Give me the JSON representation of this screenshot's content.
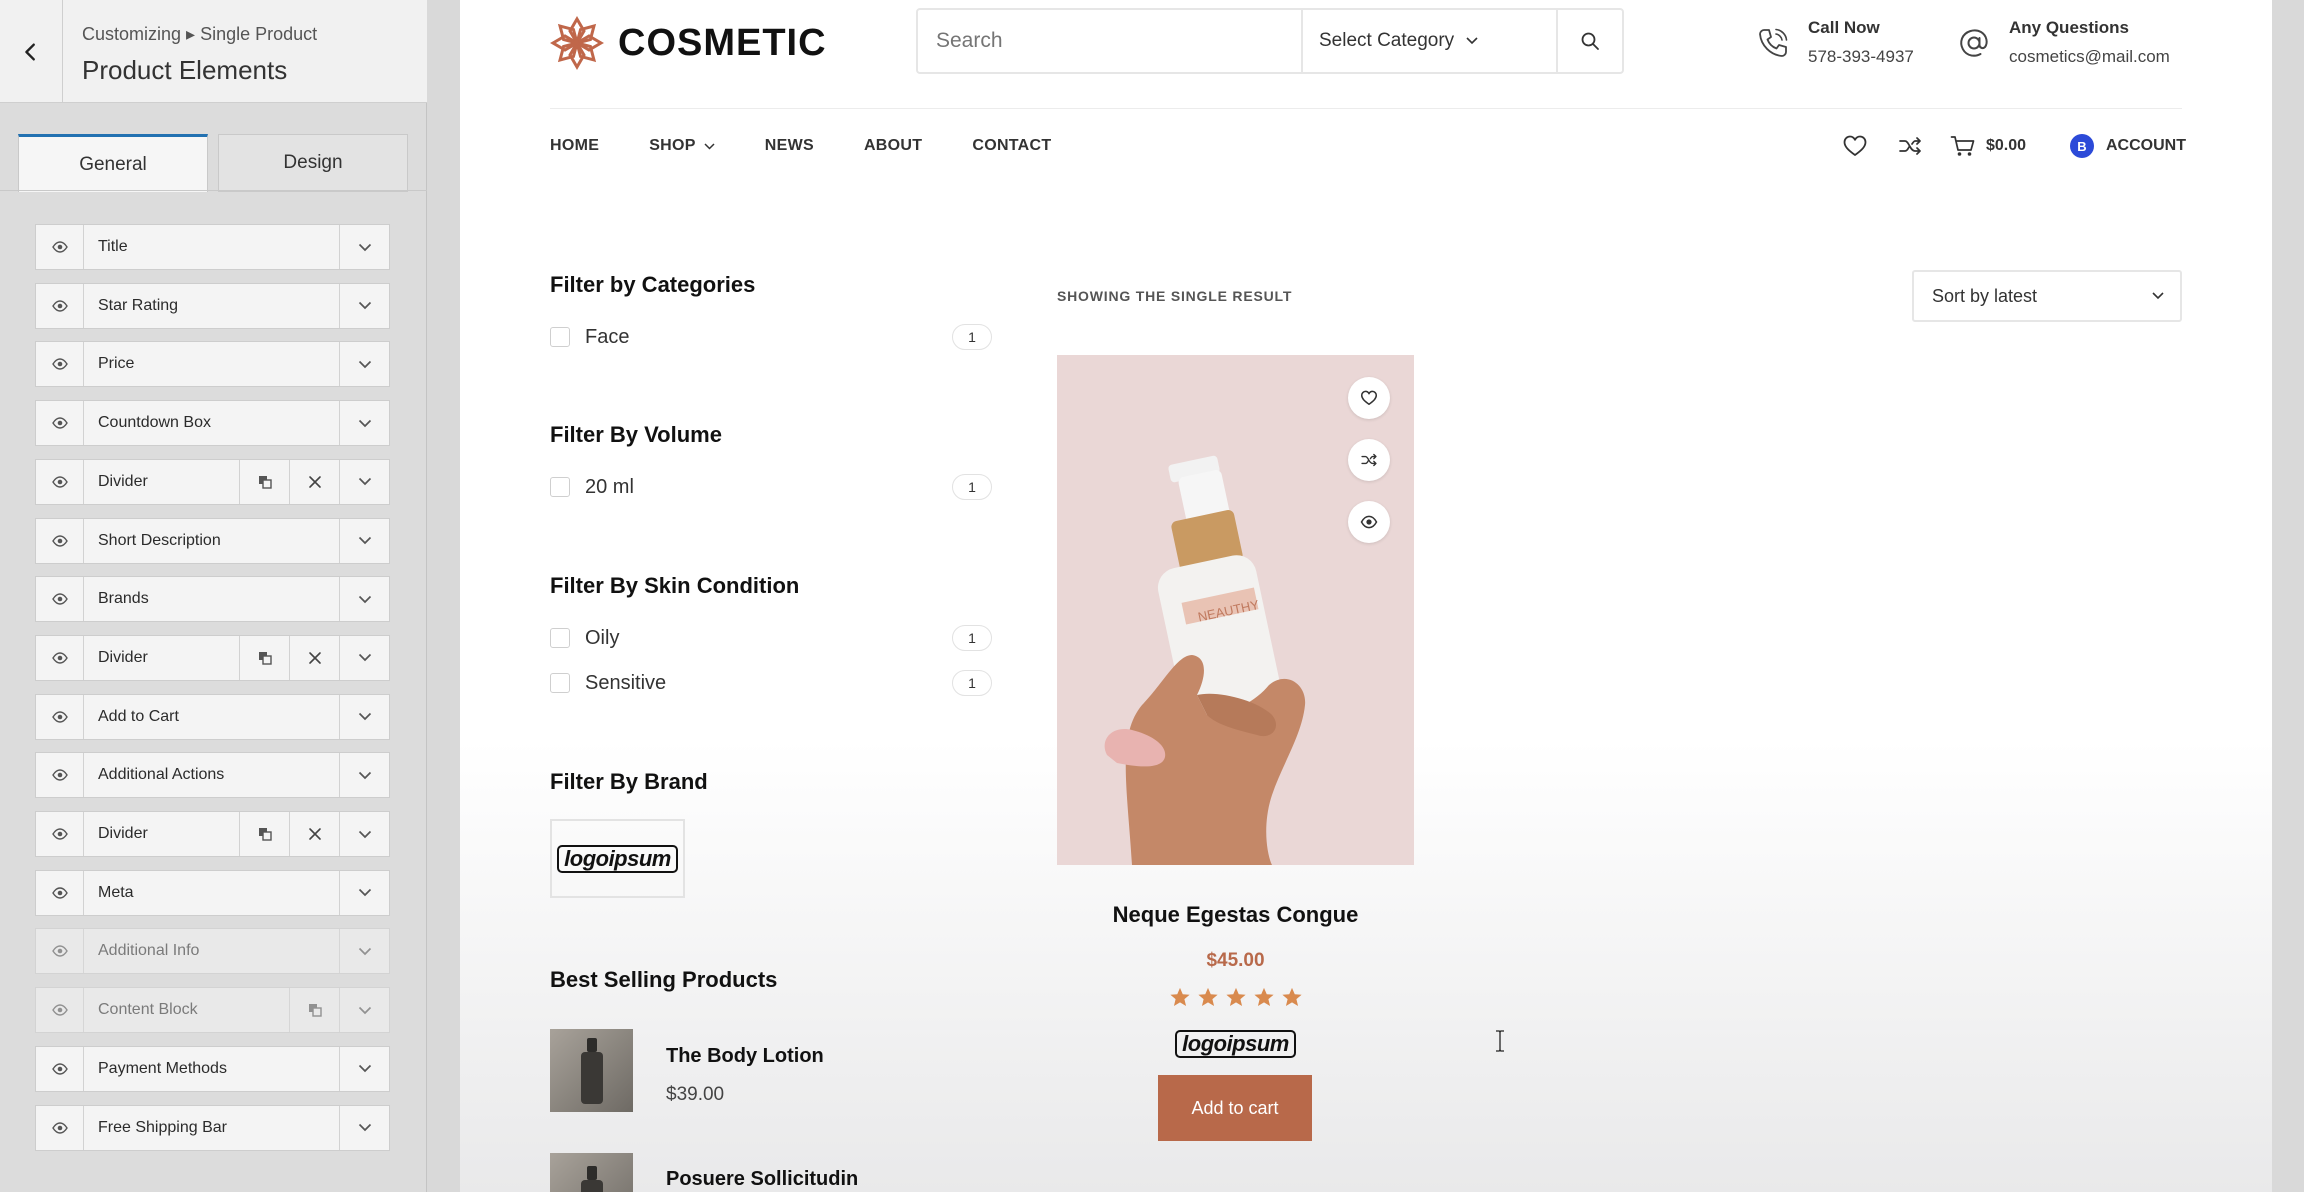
{
  "customizer": {
    "breadcrumb": "Customizing ▸ Single Product",
    "title": "Product Elements",
    "tabs": [
      {
        "label": "General",
        "active": true
      },
      {
        "label": "Design",
        "active": false
      }
    ],
    "elements": [
      {
        "label": "Title",
        "visible": true,
        "duplicable": false
      },
      {
        "label": "Star Rating",
        "visible": true,
        "duplicable": false
      },
      {
        "label": "Price",
        "visible": true,
        "duplicable": false
      },
      {
        "label": "Countdown Box",
        "visible": true,
        "duplicable": false
      },
      {
        "label": "Divider",
        "visible": true,
        "duplicable": true,
        "removable": true
      },
      {
        "label": "Short Description",
        "visible": true,
        "duplicable": false
      },
      {
        "label": "Brands",
        "visible": true,
        "duplicable": false
      },
      {
        "label": "Divider",
        "visible": true,
        "duplicable": true,
        "removable": true
      },
      {
        "label": "Add to Cart",
        "visible": true,
        "duplicable": false
      },
      {
        "label": "Additional Actions",
        "visible": true,
        "duplicable": false
      },
      {
        "label": "Divider",
        "visible": true,
        "duplicable": true,
        "removable": true
      },
      {
        "label": "Meta",
        "visible": true,
        "duplicable": false
      },
      {
        "label": "Additional Info",
        "visible": false,
        "duplicable": false
      },
      {
        "label": "Content Block",
        "visible": false,
        "duplicable": true,
        "removable": false
      },
      {
        "label": "Payment Methods",
        "visible": true,
        "duplicable": false
      },
      {
        "label": "Free Shipping Bar",
        "visible": true,
        "duplicable": false
      }
    ]
  },
  "site": {
    "logo_text": "COSMETIC",
    "search": {
      "placeholder": "Search",
      "category": "Select Category"
    },
    "call": {
      "label": "Call Now",
      "value": "578-393-4937"
    },
    "questions": {
      "label": "Any Questions",
      "value": "cosmetics@mail.com"
    },
    "nav": [
      "HOME",
      "SHOP",
      "NEWS",
      "ABOUT",
      "CONTACT"
    ],
    "cart_total": "$0.00",
    "account_badge": "B",
    "account_label": "ACCOUNT",
    "filters": {
      "categories": {
        "title": "Filter by Categories",
        "options": [
          {
            "label": "Face",
            "count": "1"
          }
        ]
      },
      "volume": {
        "title": "Filter By Volume",
        "options": [
          {
            "label": "20 ml",
            "count": "1"
          }
        ]
      },
      "skin": {
        "title": "Filter By Skin Condition",
        "options": [
          {
            "label": "Oily",
            "count": "1"
          },
          {
            "label": "Sensitive",
            "count": "1"
          }
        ]
      },
      "brand": {
        "title": "Filter By Brand",
        "logo": "logoipsum"
      }
    },
    "best_selling": {
      "title": "Best Selling Products",
      "items": [
        {
          "name": "The Body Lotion",
          "price": "$39.00"
        },
        {
          "name": "Posuere Sollicitudin",
          "price": ""
        }
      ]
    },
    "results_text": "SHOWING THE SINGLE RESULT",
    "sort": "Sort by latest",
    "product": {
      "name": "Neque Egestas Congue",
      "price": "$45.00",
      "rating": 5,
      "brand": "logoipsum",
      "button": "Add to cart",
      "bottle_label": "NEAUTHY"
    },
    "colors": {
      "accent": "#b8694a",
      "star": "#d98a4e",
      "account_badge": "#2c4ad8",
      "tab_active": "#2271b1"
    }
  }
}
